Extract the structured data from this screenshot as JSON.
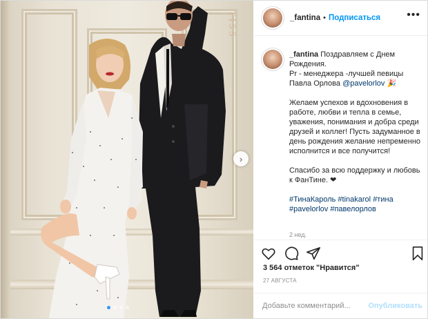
{
  "post": {
    "image_alt": "photo",
    "gallery_dots": 4,
    "gallery_active": 0,
    "next_icon": "chevron-right-icon",
    "photo_watermark": "TISS"
  },
  "header": {
    "username": "_fantina",
    "separator": "•",
    "follow_label": "Подписаться",
    "more_icon": "ellipsis-icon",
    "more_glyph": "•••"
  },
  "caption": {
    "username": "_fantina",
    "line1": "Поздравляем с Днем Рождения.",
    "line2_pre": "Pr - менеджера -лучшей певицы Павла Орлова",
    "mention": "@pavelorlov",
    "line2_emoji": "🎉",
    "paragraph2": "Желаем успехов и вдохновения в работе, любви и тепла в семье, уважения, понимания и добра среди друзей и коллег! Пусть задуманное в день рождения желание непременно исполнится и все получится!",
    "paragraph3": "Спасибо за всю поддержку и любовь к ФанТине. ❤",
    "hashtags": [
      "#ТинаКароль",
      "#tinakarol",
      "#тина",
      "#pavelorlov",
      "#павелорлов"
    ],
    "time_ago": "2 нед."
  },
  "actions": {
    "like_icon": "heart-icon",
    "comment_icon": "comment-icon",
    "share_icon": "send-icon",
    "save_icon": "bookmark-icon"
  },
  "likes_text": "3 564 отметок \"Нравится\"",
  "date_text": "27 АВГУСТА",
  "comment_box": {
    "placeholder": "Добавьте комментарий...",
    "value": "",
    "publish_label": "Опубликовать"
  },
  "colors": {
    "accent": "#0095f6",
    "link": "#00376b",
    "muted": "#8e8e8e",
    "publish_disabled": "#b2dffc"
  }
}
